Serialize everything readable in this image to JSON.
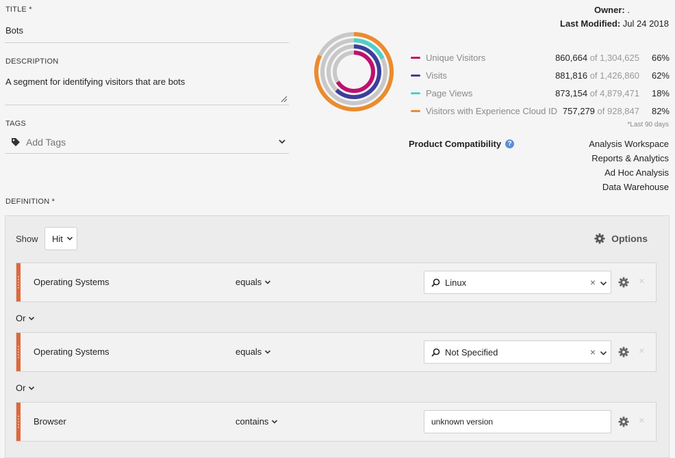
{
  "form": {
    "title_label": "TITLE *",
    "title_value": "Bots",
    "description_label": "DESCRIPTION",
    "description_value": "A segment for identifying visitors that are bots",
    "tags_label": "TAGS",
    "tags_placeholder": "Add Tags",
    "definition_label": "DEFINITION *"
  },
  "meta": {
    "owner_label": "Owner:",
    "owner_value": ".",
    "modified_label": "Last Modified:",
    "modified_value": " Jul 24 2018"
  },
  "metrics": [
    {
      "name": "Unique Visitors",
      "count": "860,664",
      "of": "of",
      "total": "1,304,625",
      "percent": "66%",
      "color": "#c0106e"
    },
    {
      "name": "Visits",
      "count": "881,816",
      "of": "of",
      "total": "1,426,860",
      "percent": "62%",
      "color": "#3b3f9a"
    },
    {
      "name": "Page Views",
      "count": "873,154",
      "of": "of",
      "total": "4,879,471",
      "percent": "18%",
      "color": "#4fcfc8"
    },
    {
      "name": "Visitors with Experience Cloud ID",
      "count": "757,279",
      "of": "of",
      "total": "928,847",
      "percent": "82%",
      "color": "#ec8b2d"
    }
  ],
  "footnote": "*Last 90 days",
  "compatibility": {
    "label": "Product Compatibility",
    "help": "?",
    "items": [
      "Analysis Workspace",
      "Reports & Analytics",
      "Ad Hoc Analysis",
      "Data Warehouse"
    ]
  },
  "definition": {
    "show_label": "Show",
    "show_value": "Hit",
    "options_label": "Options",
    "rules": [
      {
        "dimension": "Operating Systems",
        "operator": "equals",
        "value": "Linux",
        "search": true
      },
      {
        "dimension": "Operating Systems",
        "operator": "equals",
        "value": "Not Specified",
        "search": true
      },
      {
        "dimension": "Browser",
        "operator": "contains",
        "value": "unknown version",
        "search": false
      }
    ],
    "connectors": [
      "Or",
      "Or"
    ],
    "clear_glyph": "×",
    "remove_glyph": "×"
  },
  "chart_data": {
    "type": "donut",
    "series": [
      {
        "name": "Unique Visitors",
        "value": 66
      },
      {
        "name": "Visits",
        "value": 62
      },
      {
        "name": "Page Views",
        "value": 18
      },
      {
        "name": "Visitors with Experience Cloud ID",
        "value": 82
      }
    ],
    "track_color": "#c8c8c8"
  }
}
